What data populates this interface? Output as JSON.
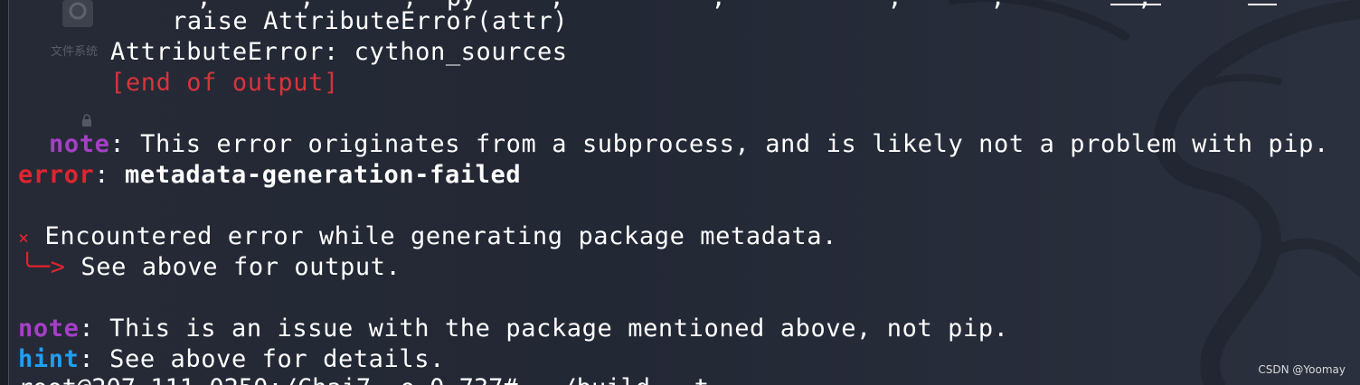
{
  "top_partial": "      ,      ,      ,  py     ,          ,           ,      ,         ,",
  "lines": {
    "raise": "raise AttributeError(attr)",
    "attr_error": "AttributeError: cython_sources",
    "end_output": "[end of output]",
    "note1_label": "note",
    "note1_text": ": This error originates from a subprocess, and is likely not a problem with pip.",
    "error_label": "error",
    "error_sep": ": ",
    "error_text": "metadata-generation-failed",
    "x_mark": "×",
    "encountered": " Encountered error while generating package metadata.",
    "arrow": "╰─>",
    "see_above": " See above for output.",
    "note2_label": "note",
    "note2_text": ": This is an issue with the package mentioned above, not pip.",
    "hint_label": "hint",
    "hint_text": ": See above for details."
  },
  "bottom_partial": "root@207-111-0250:/Chai7  o 0 737#   /build   t",
  "desktop": {
    "icon_label": "文件系统"
  },
  "watermark": "CSDN @Yoomay",
  "colors": {
    "background": "#232733",
    "error_red": "#e0242e",
    "note_purple": "#a53fc6",
    "hint_blue": "#1e9ef0",
    "text": "#ffffff"
  }
}
